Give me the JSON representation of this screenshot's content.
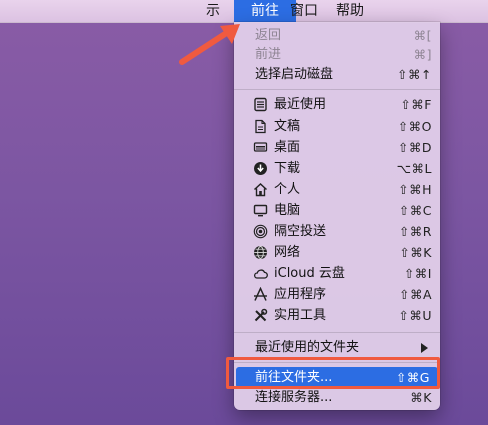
{
  "menubar": {
    "display_label": "示",
    "go_label": "前往",
    "window_label": "窗口",
    "help_label": "帮助"
  },
  "menu": {
    "items": [
      {
        "label": "返回",
        "shortcut": "⌘[",
        "disabled": true
      },
      {
        "label": "前进",
        "shortcut": "⌘]",
        "disabled": true
      },
      {
        "label": "选择启动磁盘",
        "shortcut": "⇧⌘↑"
      },
      {
        "label": "最近使用",
        "shortcut": "⇧⌘F",
        "icon": "recents-icon"
      },
      {
        "label": "文稿",
        "shortcut": "⇧⌘O",
        "icon": "documents-icon"
      },
      {
        "label": "桌面",
        "shortcut": "⇧⌘D",
        "icon": "desktop-icon"
      },
      {
        "label": "下载",
        "shortcut": "⌥⌘L",
        "icon": "downloads-icon"
      },
      {
        "label": "个人",
        "shortcut": "⇧⌘H",
        "icon": "home-icon"
      },
      {
        "label": "电脑",
        "shortcut": "⇧⌘C",
        "icon": "computer-icon"
      },
      {
        "label": "隔空投送",
        "shortcut": "⇧⌘R",
        "icon": "airdrop-icon"
      },
      {
        "label": "网络",
        "shortcut": "⇧⌘K",
        "icon": "network-icon"
      },
      {
        "label": "iCloud 云盘",
        "shortcut": "⇧⌘I",
        "icon": "icloud-icon"
      },
      {
        "label": "应用程序",
        "shortcut": "⇧⌘A",
        "icon": "applications-icon"
      },
      {
        "label": "实用工具",
        "shortcut": "⇧⌘U",
        "icon": "utilities-icon"
      },
      {
        "label": "最近使用的文件夹"
      },
      {
        "label": "前往文件夹...",
        "shortcut": "⇧⌘G",
        "selected": true
      },
      {
        "label": "连接服务器...",
        "shortcut": "⌘K"
      }
    ]
  },
  "colors": {
    "accent": "#2c6de3",
    "annotation": "#f05a3f"
  }
}
